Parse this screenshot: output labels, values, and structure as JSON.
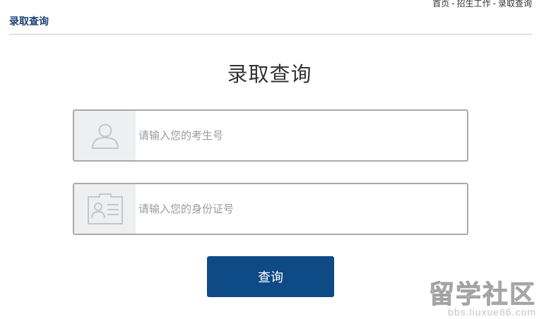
{
  "breadcrumb": {
    "items": [
      "首页",
      "招生工作",
      "录取查询"
    ],
    "separator": "-"
  },
  "section_title": "录取查询",
  "page_title": "录取查询",
  "form": {
    "exam_field": {
      "placeholder": "请输入您的考生号",
      "value": "",
      "icon": "user-icon"
    },
    "id_field": {
      "placeholder": "请输入您的身份证号",
      "value": "",
      "icon": "id-card-icon"
    },
    "submit_label": "查询"
  },
  "watermark": {
    "text": "留学社区",
    "url": "bbs.liuxue86.com"
  },
  "colors": {
    "accent": "#0d4a86",
    "section_title": "#1f3f73",
    "field_border": "#a9a9a9",
    "icon_bg": "#eeeff1",
    "placeholder": "#9a9a9a"
  }
}
